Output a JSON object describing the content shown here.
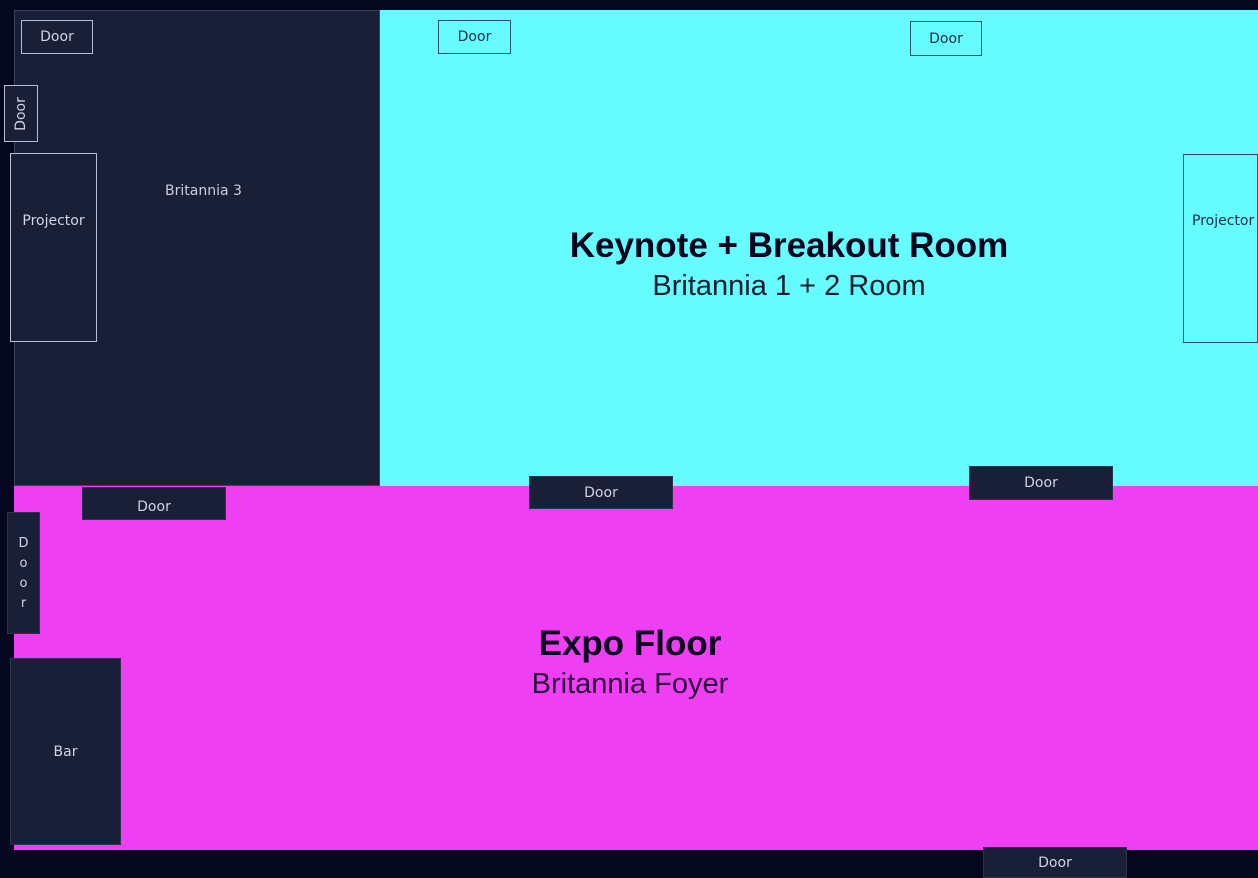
{
  "rooms": {
    "britannia3": {
      "label": "Britannia 3",
      "colors": {
        "fill": "#1a1f38"
      }
    },
    "keynote": {
      "title": "Keynote + Breakout Room",
      "subtitle": "Britannia 1 + 2 Room",
      "colors": {
        "fill": "#66fcff"
      }
    },
    "expo": {
      "title": "Expo Floor",
      "subtitle": "Britannia Foyer",
      "colors": {
        "fill": "#ef3ff3"
      }
    }
  },
  "features": {
    "door_label": "Door",
    "door_vertical_letters": [
      "D",
      "o",
      "o",
      "r"
    ],
    "projector_label": "Projector",
    "bar_label": "Bar"
  },
  "colors": {
    "background": "#05071f",
    "box_fill": "#1a1f38"
  }
}
